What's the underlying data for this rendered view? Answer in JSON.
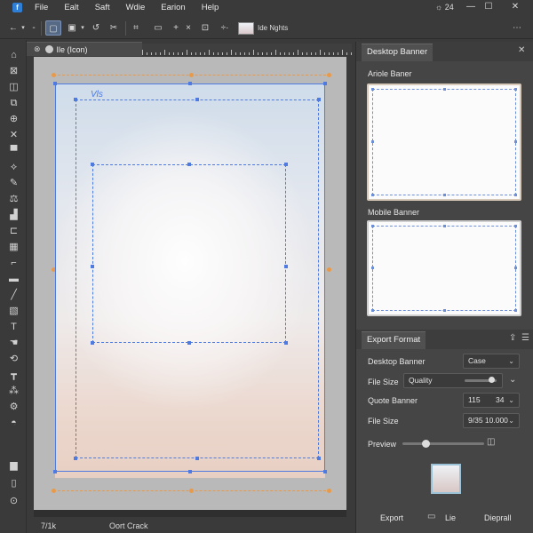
{
  "menu": {
    "logo": "f",
    "items": [
      "File",
      "Ealt",
      "Saft",
      "Wdie",
      "Earion",
      "Help"
    ],
    "window_info": "☼  24"
  },
  "toolbar": {
    "preset_label": "Ide Nghts"
  },
  "document": {
    "tab_label": "Ile (Icon)",
    "artboard_label": "Vls",
    "status_zoom": "7/1k",
    "status_mode": "Oort Crack"
  },
  "banner_panel": {
    "tab": "Desktop Banner",
    "preview1_label": "Ariole Baner",
    "preview2_label": "Mobile Banner"
  },
  "export_panel": {
    "tab": "Export Format",
    "rows": [
      {
        "label": "Desktop Banner",
        "value": "Case"
      },
      {
        "label": "File Size",
        "value": "Quality"
      },
      {
        "label": "Quote Banner",
        "value_a": "115",
        "value_b": "34"
      },
      {
        "label": "File Size",
        "value": "9/35  10.000"
      },
      {
        "label": "Preview"
      }
    ],
    "quality_level": 0.82,
    "preview_level": 0.28,
    "buttons": [
      "Export",
      "Lie",
      "Dieprall"
    ]
  },
  "colors": {
    "accent": "#4f7be0",
    "guide": "#e89a4a",
    "panel": "#454545"
  }
}
